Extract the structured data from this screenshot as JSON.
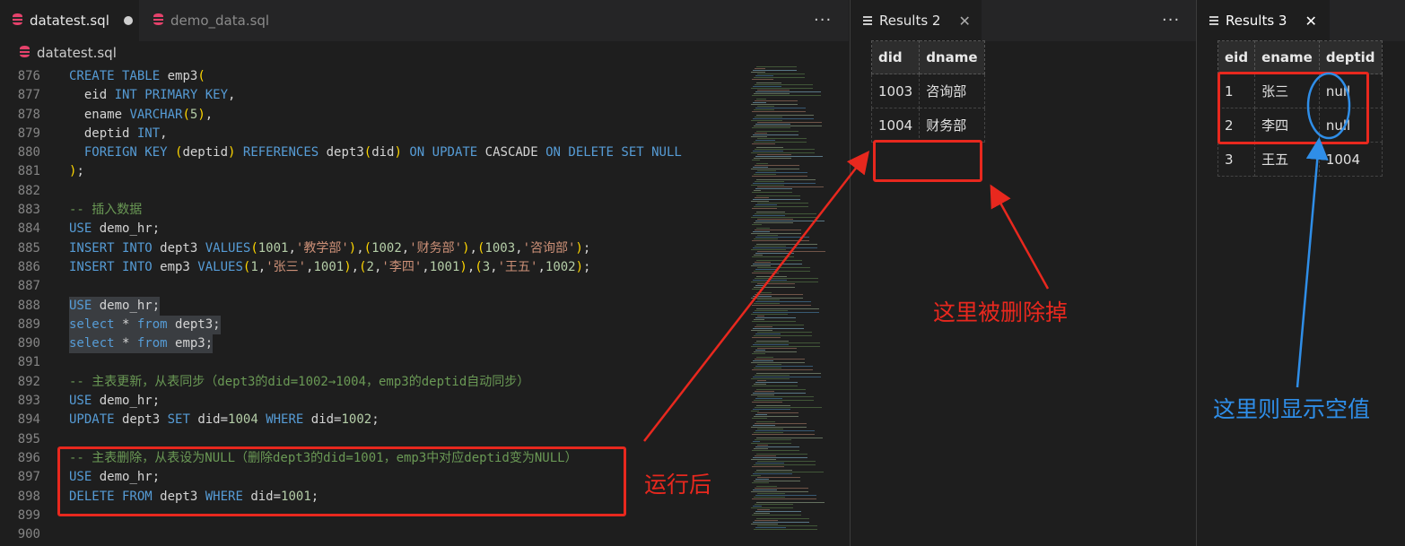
{
  "editor": {
    "tabs": [
      {
        "label": "datatest.sql",
        "modified": true
      },
      {
        "label": "demo_data.sql",
        "modified": false
      }
    ],
    "more": "···",
    "breadcrumb": "datatest.sql",
    "lines": [
      {
        "n": "876",
        "tokens": [
          [
            "kw",
            "CREATE TABLE"
          ],
          [
            "pl",
            " emp3"
          ],
          [
            "pr",
            "("
          ]
        ]
      },
      {
        "n": "877",
        "tokens": [
          [
            "pl",
            "  eid "
          ],
          [
            "kw",
            "INT PRIMARY KEY"
          ],
          [
            "pl",
            ","
          ]
        ]
      },
      {
        "n": "878",
        "tokens": [
          [
            "pl",
            "  ename "
          ],
          [
            "kw",
            "VARCHAR"
          ],
          [
            "pr",
            "("
          ],
          [
            "nm",
            "5"
          ],
          [
            "pr",
            ")"
          ],
          [
            "pl",
            ","
          ]
        ]
      },
      {
        "n": "879",
        "tokens": [
          [
            "pl",
            "  deptid "
          ],
          [
            "kw",
            "INT"
          ],
          [
            "pl",
            ","
          ]
        ]
      },
      {
        "n": "880",
        "tokens": [
          [
            "kw",
            "  FOREIGN KEY"
          ],
          [
            "pl",
            " "
          ],
          [
            "pr",
            "("
          ],
          [
            "pl",
            "deptid"
          ],
          [
            "pr",
            ")"
          ],
          [
            "kw",
            " REFERENCES"
          ],
          [
            "pl",
            " dept3"
          ],
          [
            "pr",
            "("
          ],
          [
            "pl",
            "did"
          ],
          [
            "pr",
            ")"
          ],
          [
            "kw",
            " ON UPDATE"
          ],
          [
            "pl",
            " CASCADE"
          ],
          [
            "kw",
            " ON DELETE SET NULL"
          ]
        ]
      },
      {
        "n": "881",
        "tokens": [
          [
            "pr",
            ")"
          ],
          [
            "pl",
            ";"
          ]
        ]
      },
      {
        "n": "882",
        "tokens": []
      },
      {
        "n": "883",
        "tokens": [
          [
            "cm",
            "-- 插入数据"
          ]
        ]
      },
      {
        "n": "884",
        "tokens": [
          [
            "kw",
            "USE"
          ],
          [
            "pl",
            " demo_hr;"
          ]
        ]
      },
      {
        "n": "885",
        "tokens": [
          [
            "kw",
            "INSERT INTO"
          ],
          [
            "pl",
            " dept3 "
          ],
          [
            "kw",
            "VALUES"
          ],
          [
            "pr",
            "("
          ],
          [
            "nm",
            "1001"
          ],
          [
            "pl",
            ","
          ],
          [
            "st",
            "'教学部'"
          ],
          [
            "pr",
            ")"
          ],
          [
            "pl",
            ","
          ],
          [
            "pr",
            "("
          ],
          [
            "nm",
            "1002"
          ],
          [
            "pl",
            ","
          ],
          [
            "st",
            "'财务部'"
          ],
          [
            "pr",
            ")"
          ],
          [
            "pl",
            ","
          ],
          [
            "pr",
            "("
          ],
          [
            "nm",
            "1003"
          ],
          [
            "pl",
            ","
          ],
          [
            "st",
            "'咨询部'"
          ],
          [
            "pr",
            ")"
          ],
          [
            "pl",
            ";"
          ]
        ]
      },
      {
        "n": "886",
        "tokens": [
          [
            "kw",
            "INSERT INTO"
          ],
          [
            "pl",
            " emp3 "
          ],
          [
            "kw",
            "VALUES"
          ],
          [
            "pr",
            "("
          ],
          [
            "nm",
            "1"
          ],
          [
            "pl",
            ","
          ],
          [
            "st",
            "'张三'"
          ],
          [
            "pl",
            ","
          ],
          [
            "nm",
            "1001"
          ],
          [
            "pr",
            ")"
          ],
          [
            "pl",
            ","
          ],
          [
            "pr",
            "("
          ],
          [
            "nm",
            "2"
          ],
          [
            "pl",
            ","
          ],
          [
            "st",
            "'李四'"
          ],
          [
            "pl",
            ","
          ],
          [
            "nm",
            "1001"
          ],
          [
            "pr",
            ")"
          ],
          [
            "pl",
            ","
          ],
          [
            "pr",
            "("
          ],
          [
            "nm",
            "3"
          ],
          [
            "pl",
            ","
          ],
          [
            "st",
            "'王五'"
          ],
          [
            "pl",
            ","
          ],
          [
            "nm",
            "1002"
          ],
          [
            "pr",
            ")"
          ],
          [
            "pl",
            ";"
          ]
        ]
      },
      {
        "n": "887",
        "tokens": []
      },
      {
        "n": "888",
        "sel": true,
        "tokens": [
          [
            "kw",
            "USE"
          ],
          [
            "pl",
            " demo_hr;"
          ]
        ]
      },
      {
        "n": "889",
        "sel": true,
        "tokens": [
          [
            "kw",
            "select"
          ],
          [
            "pl",
            " * "
          ],
          [
            "kw",
            "from"
          ],
          [
            "pl",
            " dept3;"
          ]
        ]
      },
      {
        "n": "890",
        "sel": true,
        "tokens": [
          [
            "kw",
            "select"
          ],
          [
            "pl",
            " * "
          ],
          [
            "kw",
            "from"
          ],
          [
            "pl",
            " emp3;"
          ]
        ]
      },
      {
        "n": "891",
        "tokens": []
      },
      {
        "n": "892",
        "tokens": [
          [
            "cm",
            "-- 主表更新，从表同步（dept3的did=1002→1004，emp3的deptid自动同步）"
          ]
        ]
      },
      {
        "n": "893",
        "tokens": [
          [
            "kw",
            "USE"
          ],
          [
            "pl",
            " demo_hr;"
          ]
        ]
      },
      {
        "n": "894",
        "tokens": [
          [
            "kw",
            "UPDATE"
          ],
          [
            "pl",
            " dept3 "
          ],
          [
            "kw",
            "SET"
          ],
          [
            "pl",
            " did="
          ],
          [
            "nm",
            "1004"
          ],
          [
            "kw",
            " WHERE"
          ],
          [
            "pl",
            " did="
          ],
          [
            "nm",
            "1002"
          ],
          [
            "pl",
            ";"
          ]
        ]
      },
      {
        "n": "895",
        "tokens": []
      },
      {
        "n": "896",
        "tokens": [
          [
            "cm",
            "-- 主表删除，从表设为NULL（删除dept3的did=1001，emp3中对应deptid变为NULL）"
          ]
        ]
      },
      {
        "n": "897",
        "tokens": [
          [
            "kw",
            "USE"
          ],
          [
            "pl",
            " demo_hr;"
          ]
        ]
      },
      {
        "n": "898",
        "tokens": [
          [
            "kw",
            "DELETE FROM"
          ],
          [
            "pl",
            " dept3 "
          ],
          [
            "kw",
            "WHERE"
          ],
          [
            "pl",
            " did="
          ],
          [
            "nm",
            "1001"
          ],
          [
            "pl",
            ";"
          ]
        ]
      },
      {
        "n": "899",
        "tokens": []
      },
      {
        "n": "900",
        "tokens": []
      }
    ]
  },
  "results2": {
    "tab_label": "Results 2",
    "close": "✕",
    "more": "···",
    "columns": [
      "did",
      "dname"
    ],
    "rows": [
      [
        "1003",
        "咨询部"
      ],
      [
        "1004",
        "财务部"
      ]
    ]
  },
  "results3": {
    "tab_label": "Results 3",
    "close": "✕",
    "columns": [
      "eid",
      "ename",
      "deptid"
    ],
    "rows": [
      [
        "1",
        "张三",
        "null"
      ],
      [
        "2",
        "李四",
        "null"
      ],
      [
        "3",
        "王五",
        "1004"
      ]
    ]
  },
  "annotations": {
    "after_run": "运行后",
    "deleted_here": "这里被删除掉",
    "null_here": "这里则显示空值"
  },
  "colors": {
    "annotation_red": "#e8281e",
    "annotation_blue": "#2f8ee8"
  }
}
